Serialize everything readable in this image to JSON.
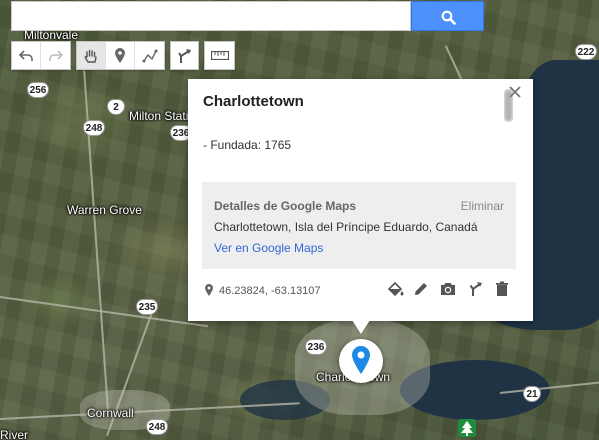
{
  "search": {
    "placeholder": "",
    "value": ""
  },
  "toolbar": {
    "undo": "undo-icon",
    "redo": "redo-icon",
    "pan": "hand-icon",
    "marker": "marker-icon",
    "line": "draw-line-icon",
    "directions": "directions-icon",
    "measure": "ruler-icon"
  },
  "map": {
    "labels": {
      "miltonvale": "Miltonvale",
      "milton_station": "Milton Stati",
      "warren_grove": "Warren Grove",
      "charlottetown": "Charlottetown",
      "cornwall": "Cornwall",
      "river": "River"
    },
    "shields": [
      "256",
      "2",
      "248",
      "236",
      "235",
      "236",
      "248",
      "222",
      "21"
    ]
  },
  "info": {
    "title": "Charlottetown",
    "description": "- Fundada: 1765",
    "gm_title": "Detalles de Google Maps",
    "gm_remove": "Eliminar",
    "gm_address": "Charlottetown, Isla del Príncipe Eduardo, Canadá",
    "gm_link": "Ver en Google Maps",
    "coordinates": "46.23824, -63.13107",
    "actions": [
      "paint-bucket-icon",
      "edit-pencil-icon",
      "camera-icon",
      "directions-icon",
      "delete-icon"
    ]
  },
  "colors": {
    "accent": "#4d90fe",
    "marker": "#1e88e5",
    "link": "#3367d6"
  }
}
